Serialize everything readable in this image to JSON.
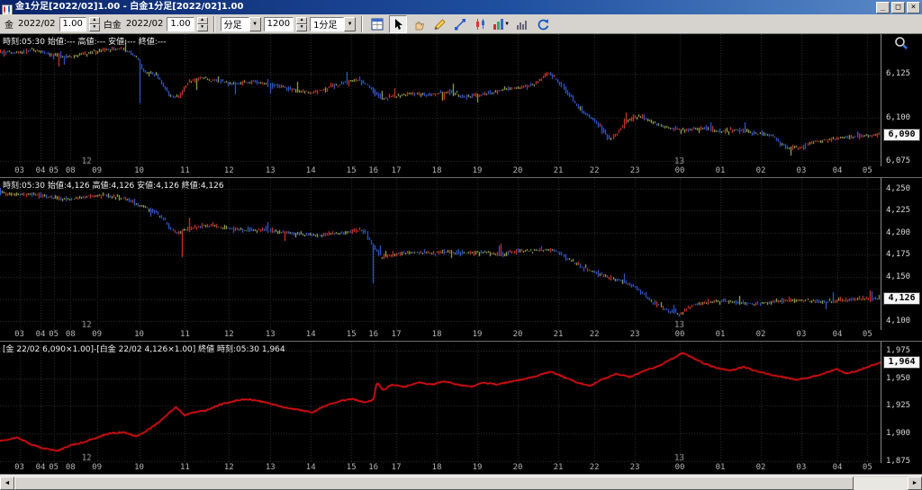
{
  "window": {
    "title": "金1分足[2022/02]1.00 - 白金1分足[2022/02]1.00",
    "minimize": "_",
    "maximize": "□",
    "close": "×"
  },
  "toolbar": {
    "gold_label": "金",
    "gold_contract": "2022/02",
    "gold_multiplier": "1.00",
    "platinum_label": "白金",
    "platinum_contract": "2022/02",
    "platinum_multiplier": "1.00",
    "interval_type": "分足",
    "bar_count": "1200",
    "interval": "1分足",
    "icons": [
      "chart-settings",
      "select-tool",
      "pan-hand",
      "draw-pencil",
      "trendline",
      "chart-type",
      "indicator",
      "histogram",
      "refresh"
    ]
  },
  "panels": [
    {
      "info": "時刻:05:30 始値:--- 高値:--- 安値:--- 終値:---",
      "badge": "6,090"
    },
    {
      "info": "時刻:05:30 始値:4,126 高値:4,126 安値:4,126 終値:4,126",
      "badge": "4,126"
    },
    {
      "info": "[金 22/02 6,090×1.00]-[白金 22/02 4,126×1.00] 終値 時刻:05:30 1,964",
      "badge": "1,964"
    }
  ],
  "x_axis": {
    "hours": [
      {
        "f": 0.022,
        "label": "03"
      },
      {
        "f": 0.046,
        "label": "04"
      },
      {
        "f": 0.061,
        "label": "05"
      },
      {
        "f": 0.08,
        "label": "08"
      },
      {
        "f": 0.11,
        "label": "09"
      },
      {
        "f": 0.158,
        "label": "10"
      },
      {
        "f": 0.21,
        "label": "11"
      },
      {
        "f": 0.26,
        "label": "12"
      },
      {
        "f": 0.307,
        "label": "13"
      },
      {
        "f": 0.353,
        "label": "14"
      },
      {
        "f": 0.399,
        "label": "15"
      },
      {
        "f": 0.424,
        "label": "16"
      },
      {
        "f": 0.45,
        "label": "17"
      },
      {
        "f": 0.496,
        "label": "18"
      },
      {
        "f": 0.542,
        "label": "19"
      },
      {
        "f": 0.588,
        "label": "20"
      },
      {
        "f": 0.634,
        "label": "21"
      },
      {
        "f": 0.675,
        "label": "22"
      },
      {
        "f": 0.721,
        "label": "23"
      },
      {
        "f": 0.772,
        "label": "00"
      },
      {
        "f": 0.818,
        "label": "01"
      },
      {
        "f": 0.864,
        "label": "02"
      },
      {
        "f": 0.91,
        "label": "03"
      },
      {
        "f": 0.951,
        "label": "04"
      },
      {
        "f": 0.985,
        "label": "05"
      }
    ],
    "days": [
      {
        "f": 0.097,
        "label": "12"
      },
      {
        "f": 0.77,
        "label": "13"
      }
    ]
  },
  "chart_data": [
    {
      "type": "candlestick",
      "name": "gold-1min",
      "ylim": [
        6072,
        6148
      ],
      "yticks": [
        {
          "v": 6125,
          "label": "6,125"
        },
        {
          "v": 6100,
          "label": "6,100"
        },
        {
          "v": 6075,
          "label": "6,075"
        }
      ],
      "badge_value": 6090,
      "bars": 480,
      "volatility": 1.7,
      "colors": {
        "up": "#ff4030",
        "down": "#3d6cff",
        "flat": "#b8cc60"
      },
      "spikes": [
        [
          0.158,
          6108
        ],
        [
          0.9,
          6078
        ]
      ],
      "waypoints": [
        [
          0,
          6138
        ],
        [
          0.02,
          6137
        ],
        [
          0.04,
          6139
        ],
        [
          0.06,
          6136
        ],
        [
          0.08,
          6135
        ],
        [
          0.1,
          6137
        ],
        [
          0.12,
          6139
        ],
        [
          0.14,
          6140
        ],
        [
          0.155,
          6136
        ],
        [
          0.165,
          6127
        ],
        [
          0.18,
          6124
        ],
        [
          0.195,
          6113
        ],
        [
          0.205,
          6112
        ],
        [
          0.215,
          6120
        ],
        [
          0.23,
          6123
        ],
        [
          0.25,
          6121
        ],
        [
          0.27,
          6119
        ],
        [
          0.29,
          6121
        ],
        [
          0.31,
          6119
        ],
        [
          0.33,
          6117
        ],
        [
          0.35,
          6114
        ],
        [
          0.37,
          6116
        ],
        [
          0.39,
          6120
        ],
        [
          0.41,
          6122
        ],
        [
          0.42,
          6118
        ],
        [
          0.435,
          6111
        ],
        [
          0.45,
          6112
        ],
        [
          0.47,
          6114
        ],
        [
          0.49,
          6113
        ],
        [
          0.51,
          6115
        ],
        [
          0.53,
          6112
        ],
        [
          0.55,
          6113
        ],
        [
          0.57,
          6116
        ],
        [
          0.59,
          6117
        ],
        [
          0.61,
          6119
        ],
        [
          0.625,
          6126
        ],
        [
          0.635,
          6122
        ],
        [
          0.65,
          6112
        ],
        [
          0.665,
          6103
        ],
        [
          0.675,
          6100
        ],
        [
          0.685,
          6095
        ],
        [
          0.695,
          6088
        ],
        [
          0.705,
          6092
        ],
        [
          0.715,
          6099
        ],
        [
          0.73,
          6101
        ],
        [
          0.745,
          6097
        ],
        [
          0.76,
          6094
        ],
        [
          0.78,
          6093
        ],
        [
          0.8,
          6094
        ],
        [
          0.82,
          6092
        ],
        [
          0.84,
          6093
        ],
        [
          0.86,
          6091
        ],
        [
          0.88,
          6090
        ],
        [
          0.895,
          6083
        ],
        [
          0.91,
          6082
        ],
        [
          0.925,
          6086
        ],
        [
          0.945,
          6087
        ],
        [
          0.965,
          6089
        ],
        [
          1,
          6090
        ]
      ]
    },
    {
      "type": "candlestick",
      "name": "platinum-1min",
      "ylim": [
        4090,
        4262
      ],
      "yticks": [
        {
          "v": 4250,
          "label": "4,250"
        },
        {
          "v": 4225,
          "label": "4,225"
        },
        {
          "v": 4200,
          "label": "4,200"
        },
        {
          "v": 4175,
          "label": "4,175"
        },
        {
          "v": 4150,
          "label": "4,150"
        },
        {
          "v": 4125,
          "label": ""
        },
        {
          "v": 4100,
          "label": "4,100"
        }
      ],
      "badge_value": 4126,
      "bars": 480,
      "volatility": 3.2,
      "colors": {
        "up": "#ff4030",
        "down": "#3d6cff",
        "flat": "#b8cc60"
      },
      "spikes": [
        [
          0.206,
          4172
        ],
        [
          0.424,
          4143
        ]
      ],
      "waypoints": [
        [
          0,
          4246
        ],
        [
          0.02,
          4243
        ],
        [
          0.04,
          4244
        ],
        [
          0.06,
          4240
        ],
        [
          0.08,
          4238
        ],
        [
          0.1,
          4241
        ],
        [
          0.12,
          4243
        ],
        [
          0.14,
          4240
        ],
        [
          0.155,
          4233
        ],
        [
          0.17,
          4228
        ],
        [
          0.185,
          4218
        ],
        [
          0.2,
          4200
        ],
        [
          0.21,
          4203
        ],
        [
          0.225,
          4207
        ],
        [
          0.245,
          4208
        ],
        [
          0.26,
          4205
        ],
        [
          0.28,
          4203
        ],
        [
          0.3,
          4204
        ],
        [
          0.32,
          4201
        ],
        [
          0.34,
          4199
        ],
        [
          0.36,
          4197
        ],
        [
          0.38,
          4199
        ],
        [
          0.4,
          4201
        ],
        [
          0.415,
          4203
        ],
        [
          0.425,
          4185
        ],
        [
          0.435,
          4172
        ],
        [
          0.45,
          4176
        ],
        [
          0.47,
          4178
        ],
        [
          0.49,
          4177
        ],
        [
          0.51,
          4179
        ],
        [
          0.53,
          4177
        ],
        [
          0.55,
          4178
        ],
        [
          0.57,
          4176
        ],
        [
          0.59,
          4179
        ],
        [
          0.61,
          4180
        ],
        [
          0.63,
          4181
        ],
        [
          0.645,
          4172
        ],
        [
          0.66,
          4163
        ],
        [
          0.675,
          4157
        ],
        [
          0.69,
          4151
        ],
        [
          0.705,
          4146
        ],
        [
          0.72,
          4141
        ],
        [
          0.733,
          4131
        ],
        [
          0.745,
          4121
        ],
        [
          0.76,
          4112
        ],
        [
          0.775,
          4108
        ],
        [
          0.785,
          4116
        ],
        [
          0.8,
          4121
        ],
        [
          0.82,
          4123
        ],
        [
          0.84,
          4121
        ],
        [
          0.86,
          4119
        ],
        [
          0.88,
          4122
        ],
        [
          0.9,
          4124
        ],
        [
          0.92,
          4123
        ],
        [
          0.94,
          4121
        ],
        [
          0.96,
          4124
        ],
        [
          0.98,
          4125
        ],
        [
          1,
          4126
        ]
      ]
    },
    {
      "type": "line",
      "name": "spread-gold-minus-platinum",
      "ylim": [
        1873,
        1983
      ],
      "yticks": [
        {
          "v": 1975,
          "label": "1,975"
        },
        {
          "v": 1950,
          "label": "1,950"
        },
        {
          "v": 1925,
          "label": "1,925"
        },
        {
          "v": 1900,
          "label": "1,900"
        },
        {
          "v": 1875,
          "label": "1,875"
        }
      ],
      "badge_value": 1964,
      "color": "#ff1212",
      "noise": 1.1,
      "waypoints": [
        [
          0,
          1893
        ],
        [
          0.02,
          1896
        ],
        [
          0.035,
          1890
        ],
        [
          0.05,
          1886
        ],
        [
          0.065,
          1884
        ],
        [
          0.08,
          1889
        ],
        [
          0.095,
          1892
        ],
        [
          0.11,
          1896
        ],
        [
          0.125,
          1900
        ],
        [
          0.14,
          1901
        ],
        [
          0.155,
          1897
        ],
        [
          0.17,
          1904
        ],
        [
          0.185,
          1913
        ],
        [
          0.2,
          1924
        ],
        [
          0.21,
          1916
        ],
        [
          0.22,
          1919
        ],
        [
          0.235,
          1921
        ],
        [
          0.25,
          1926
        ],
        [
          0.265,
          1929
        ],
        [
          0.28,
          1931
        ],
        [
          0.295,
          1929
        ],
        [
          0.31,
          1926
        ],
        [
          0.325,
          1923
        ],
        [
          0.34,
          1921
        ],
        [
          0.355,
          1919
        ],
        [
          0.37,
          1925
        ],
        [
          0.385,
          1929
        ],
        [
          0.4,
          1931
        ],
        [
          0.415,
          1928
        ],
        [
          0.424,
          1930
        ],
        [
          0.428,
          1947
        ],
        [
          0.435,
          1939
        ],
        [
          0.445,
          1944
        ],
        [
          0.46,
          1942
        ],
        [
          0.475,
          1946
        ],
        [
          0.49,
          1944
        ],
        [
          0.505,
          1947
        ],
        [
          0.52,
          1944
        ],
        [
          0.535,
          1942
        ],
        [
          0.55,
          1946
        ],
        [
          0.565,
          1944
        ],
        [
          0.58,
          1947
        ],
        [
          0.595,
          1949
        ],
        [
          0.61,
          1952
        ],
        [
          0.625,
          1956
        ],
        [
          0.64,
          1951
        ],
        [
          0.655,
          1946
        ],
        [
          0.67,
          1943
        ],
        [
          0.685,
          1949
        ],
        [
          0.7,
          1954
        ],
        [
          0.715,
          1951
        ],
        [
          0.73,
          1956
        ],
        [
          0.745,
          1960
        ],
        [
          0.76,
          1966
        ],
        [
          0.775,
          1973
        ],
        [
          0.785,
          1969
        ],
        [
          0.8,
          1963
        ],
        [
          0.815,
          1959
        ],
        [
          0.83,
          1957
        ],
        [
          0.845,
          1960
        ],
        [
          0.86,
          1956
        ],
        [
          0.875,
          1953
        ],
        [
          0.89,
          1951
        ],
        [
          0.905,
          1948
        ],
        [
          0.92,
          1951
        ],
        [
          0.935,
          1954
        ],
        [
          0.95,
          1958
        ],
        [
          0.962,
          1954
        ],
        [
          0.975,
          1957
        ],
        [
          0.988,
          1961
        ],
        [
          1,
          1964
        ]
      ]
    }
  ]
}
